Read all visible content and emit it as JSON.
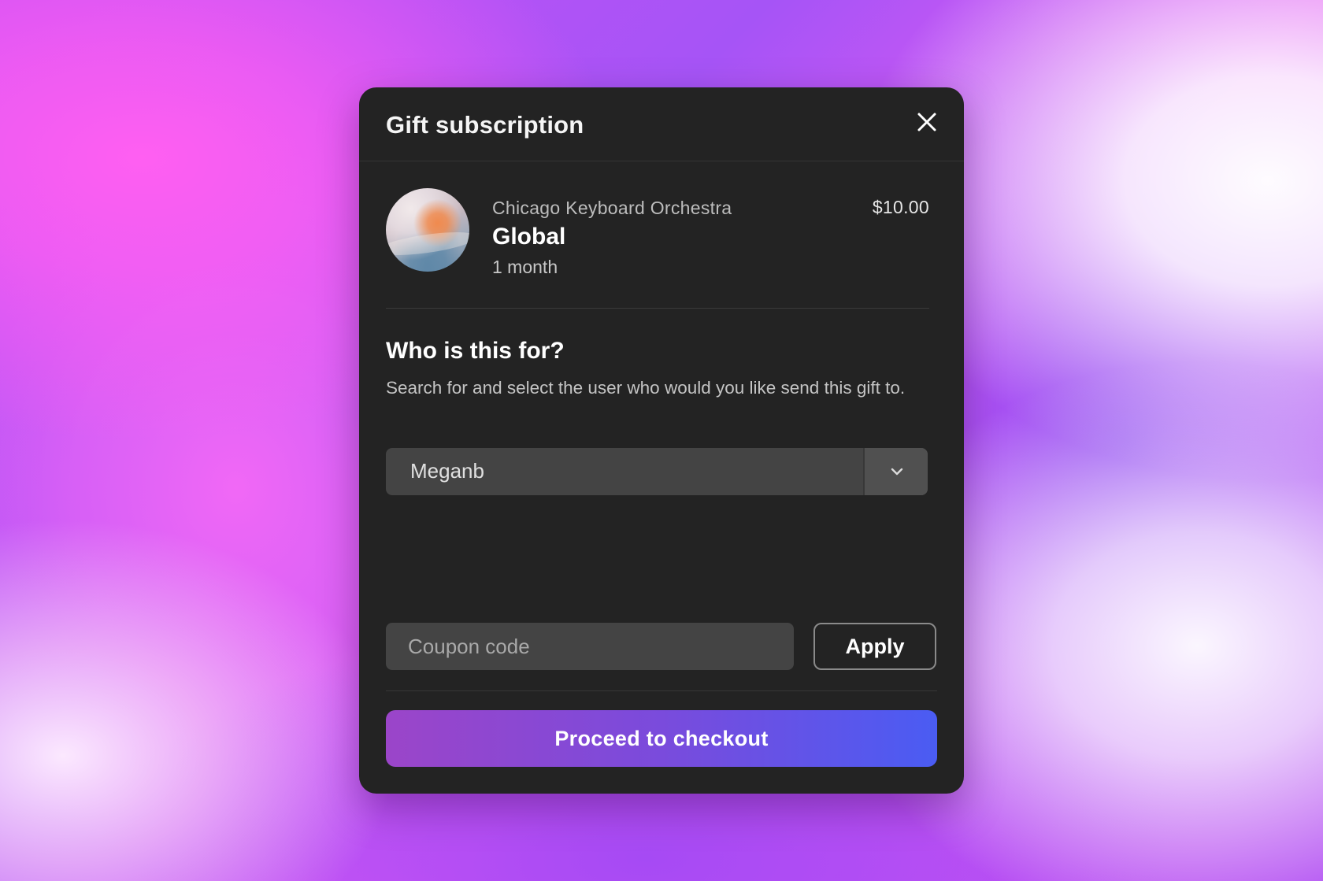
{
  "modal": {
    "title": "Gift subscription",
    "close_icon": "close-icon"
  },
  "product": {
    "avatar_icon": "orchestra-avatar",
    "organization": "Chicago Keyboard Orchestra",
    "plan": "Global",
    "duration": "1 month",
    "price": "$10.00"
  },
  "recipient": {
    "heading": "Who is this for?",
    "description": "Search for and select the user who would you like send this gift to.",
    "selected_user": "Meganb",
    "caret_icon": "chevron-down-icon"
  },
  "coupon": {
    "placeholder": "Coupon code",
    "value": "",
    "apply_label": "Apply"
  },
  "checkout": {
    "label": "Proceed to checkout"
  },
  "colors": {
    "modal_background": "#232323",
    "field_background": "#444444",
    "checkout_gradient_start": "#9b45c9",
    "checkout_gradient_end": "#4a5cf3"
  }
}
